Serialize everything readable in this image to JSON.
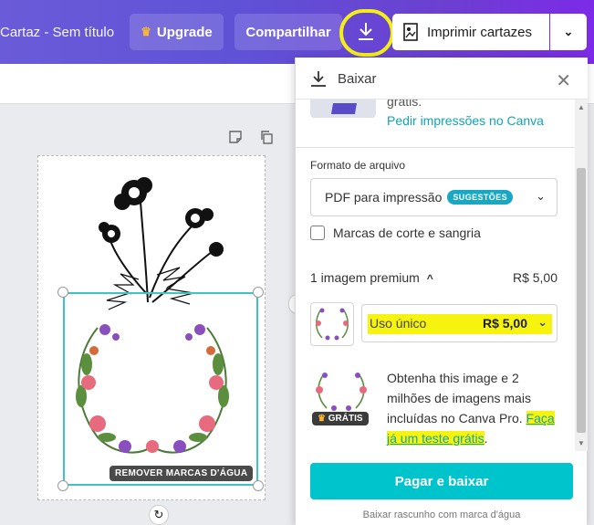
{
  "header": {
    "doc_title": "Cartaz - Sem título",
    "upgrade_label": "Upgrade",
    "share_label": "Compartilhar",
    "print_label": "Imprimir cartazes"
  },
  "canvas": {
    "remove_watermark_label": "REMOVER MARCAS D'ÁGUA"
  },
  "download_panel": {
    "title": "Baixar",
    "top_faded_text": "grátis.",
    "print_link": "Pedir impressões no Canva",
    "file_format_label": "Formato de arquivo",
    "file_format_value": "PDF para impressão",
    "file_format_badge": "SUGESTÕES",
    "crop_marks_label": "Marcas de corte e sangria",
    "premium_label": "1 imagem premium",
    "premium_price": "R$ 5,00",
    "license_label": "Uso único",
    "license_price": "R$ 5,00",
    "gratis_badge": "GRÁTIS",
    "pro_text_1": "Obtenha this image e 2 milhões de imagens mais incluídas no Canva Pro.",
    "pro_link_1": "Faça",
    "pro_link_2": "já um teste grátis",
    "pro_text_end": ".",
    "pay_button": "Pagar e baixar",
    "draft_link": "Baixar rascunho com marca d'água"
  },
  "colors": {
    "accent": "#00c4cc",
    "highlight": "#f6f30e",
    "link": "#12a4b5",
    "topbar_start": "#6a5bd8",
    "topbar_end": "#7d2ae8"
  }
}
